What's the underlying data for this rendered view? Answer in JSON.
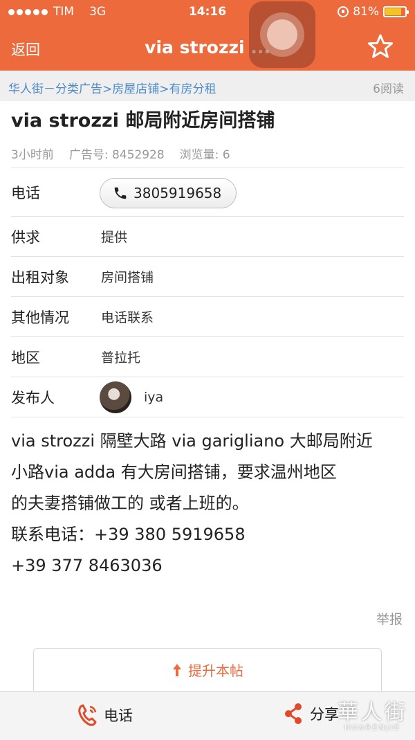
{
  "status_bar": {
    "carrier": "TIM",
    "network": "3G",
    "time": "14:16",
    "battery": "81%",
    "battery_level": 0.81
  },
  "nav": {
    "back_label": "返回",
    "title": "via strozzi ...",
    "favorite_icon": "star-outline-icon"
  },
  "breadcrumb": {
    "path": "华人街－分类广告>房屋店铺>有房分租",
    "reads": "6阅读"
  },
  "post": {
    "title": "via strozzi 邮局附近房间搭铺",
    "posted_ago": "3小时前",
    "ad_number": "广告号: 8452928",
    "views": "浏览量: 6"
  },
  "details": {
    "phone_label": "电话",
    "phone_value": "3805919658",
    "supply_label": "供求",
    "supply_value": "提供",
    "target_label": "出租对象",
    "target_value": "房间搭铺",
    "other_label": "其他情况",
    "other_value": "电话联系",
    "area_label": "地区",
    "area_value": "普拉托",
    "poster_label": "发布人",
    "poster_name": "iya"
  },
  "description": {
    "lines": [
      "via strozzi 隔壁大路 via garigliano 大邮局附近",
      "小路via adda 有大房间搭铺，要求温州地区",
      "的夫妻搭铺做工的 或者上班的。",
      "联系电话：+39 380 5919658",
      "+39 377 8463036"
    ]
  },
  "actions": {
    "report": "举报",
    "promote": "提升本帖"
  },
  "bottom_bar": {
    "call_label": "电话",
    "share_label": "分享"
  },
  "watermark": {
    "cn": "華人街",
    "en": "HUARENJIE"
  },
  "colors": {
    "brand": "#ec6a3c",
    "link": "#4d8ac9",
    "muted": "#999999"
  }
}
